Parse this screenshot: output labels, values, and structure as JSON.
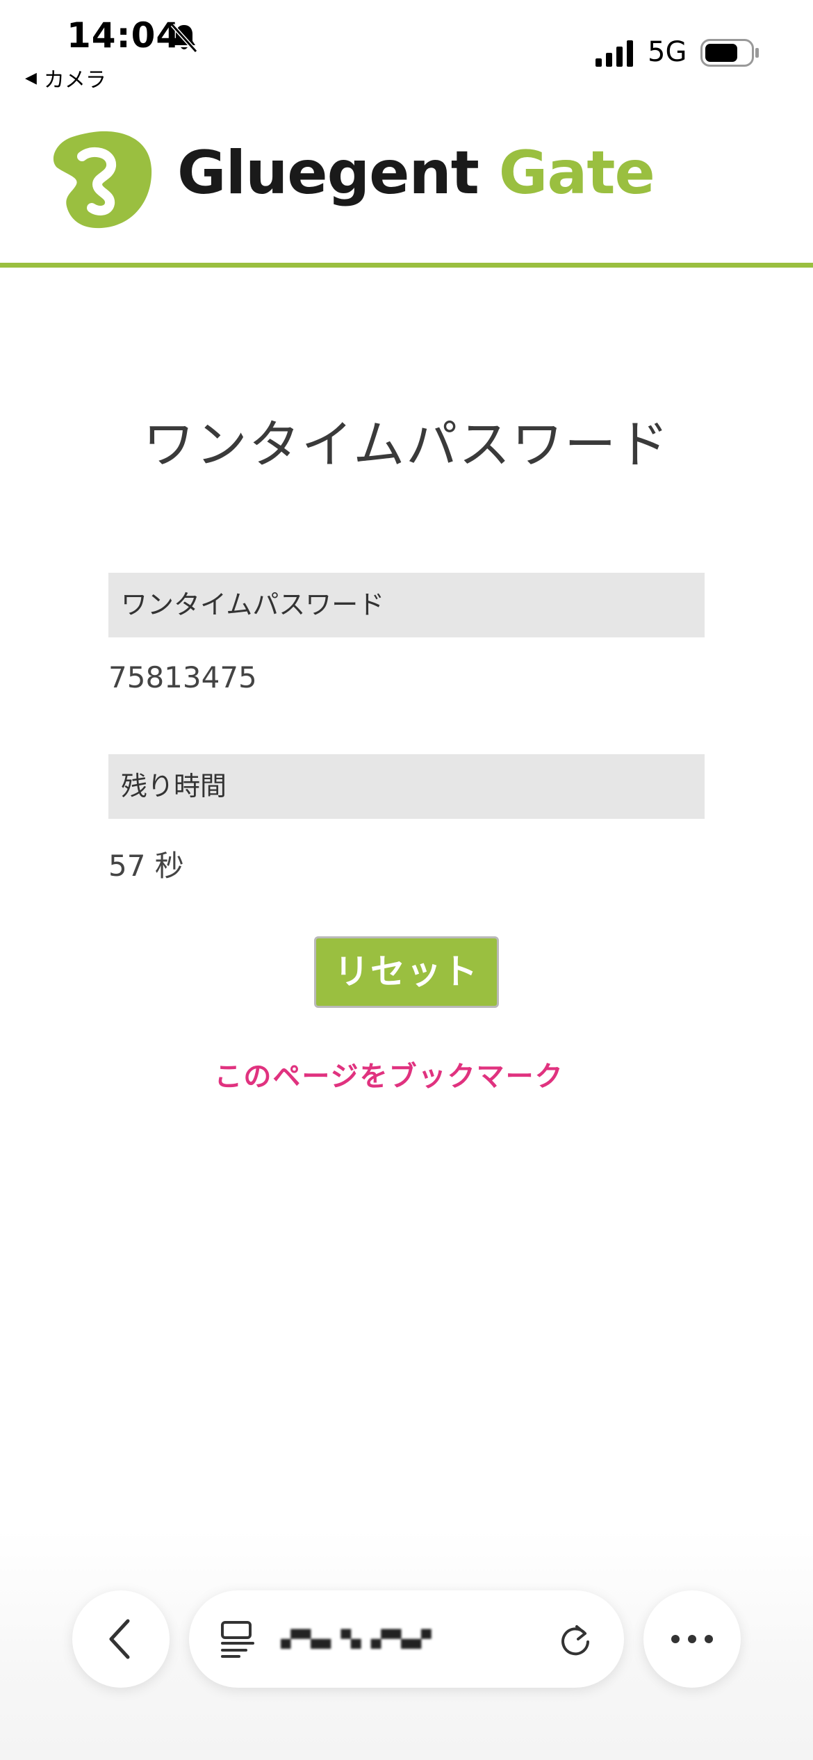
{
  "status_bar": {
    "time": "14:04",
    "back_app": "カメラ",
    "network": "5G",
    "icons": [
      "bell-slash-icon",
      "signal-icon",
      "battery-icon"
    ]
  },
  "header": {
    "brand_word1": "Gluegent",
    "brand_word2": "Gate",
    "brand_color": "#9abf40",
    "logo_icon": "gluegent-logo-icon"
  },
  "main": {
    "title": "ワンタイムパスワード",
    "otp_label": "ワンタイムパスワード",
    "otp_value": "75813475",
    "remaining_label": "残り時間",
    "remaining_value": "57 秒",
    "reset_button": "リセット",
    "bookmark_link": "このページをブックマーク",
    "link_color": "#e0327f"
  },
  "browser_bar": {
    "url": "▄▀▀▄▄ ▀▄ ▄▀▀▄▄▀",
    "icons": [
      "chevron-left-icon",
      "tabs-icon",
      "reload-icon",
      "more-icon"
    ]
  }
}
